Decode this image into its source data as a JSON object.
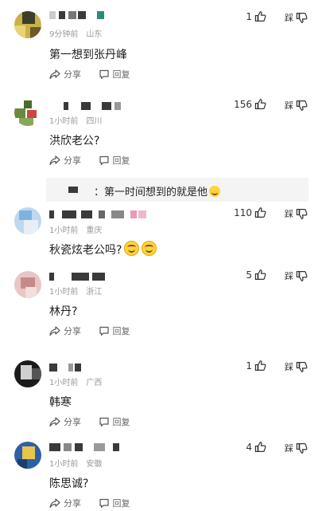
{
  "ui": {
    "share_label": "分享",
    "reply_label": "回复",
    "dislike_label": "踩"
  },
  "comments": [
    {
      "time": "9分钟前",
      "location": "山东",
      "text": "第一想到张丹峰",
      "likes": "1"
    },
    {
      "time": "1小时前",
      "location": "四川",
      "text": "洪欣老公?",
      "likes": "156",
      "reply_preview": "：第一时间想到的就是他"
    },
    {
      "time": "1小时前",
      "location": "重庆",
      "text": "秋瓷炫老公吗?",
      "likes": "110"
    },
    {
      "time": "1小时前",
      "location": "浙江",
      "text": "林丹?",
      "likes": "5"
    },
    {
      "time": "1小时前",
      "location": "广西",
      "text": "韩寒",
      "likes": "1"
    },
    {
      "time": "1小时前",
      "location": "安徽",
      "text": "陈思诚?",
      "likes": "4"
    }
  ],
  "icons": {
    "share": "share-icon",
    "reply": "comment-icon",
    "like": "thumbs-up-icon",
    "dislike": "thumbs-down-icon",
    "reply_emoji": "laughing-emoji",
    "smile_emoji": "smile-emoji"
  }
}
